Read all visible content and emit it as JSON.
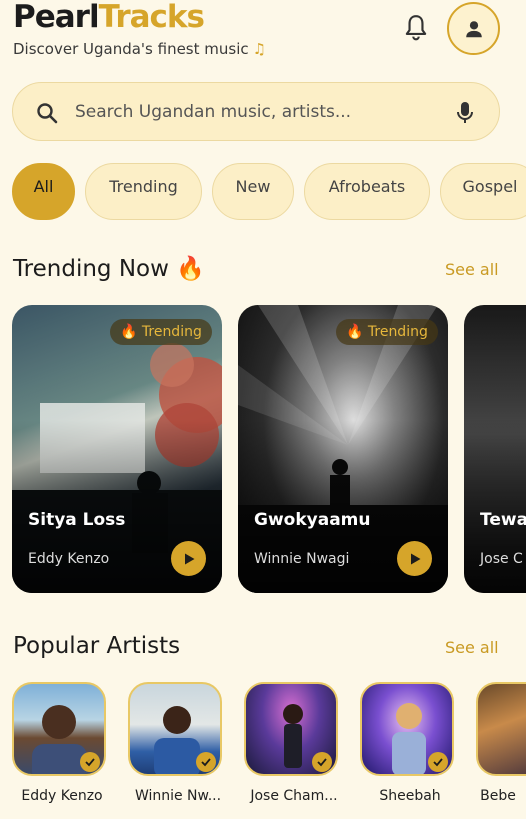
{
  "brand": {
    "part1": "Pearl",
    "part2": "Tracks"
  },
  "tagline": "Discover Uganda's finest music",
  "tagline_icon": "music-note-icon",
  "search": {
    "placeholder": "Search Ugandan music, artists..."
  },
  "filters": [
    "All",
    "Trending",
    "New",
    "Afrobeats",
    "Gospel"
  ],
  "active_filter": "All",
  "trending": {
    "title": "Trending Now 🔥",
    "see_all": "See all",
    "cards": [
      {
        "title": "Sitya Loss",
        "artist": "Eddy Kenzo",
        "badge": "🔥 Trending"
      },
      {
        "title": "Gwokyaamu",
        "artist": "Winnie Nwagi",
        "badge": "🔥 Trending"
      },
      {
        "title": "Tewa",
        "artist": "Jose C",
        "badge": ""
      }
    ]
  },
  "artists": {
    "title": "Popular Artists",
    "see_all": "See all",
    "items": [
      {
        "name": "Eddy Kenzo"
      },
      {
        "name": "Winnie Nw..."
      },
      {
        "name": "Jose Cham..."
      },
      {
        "name": "Sheebah"
      },
      {
        "name": "Bebe"
      }
    ]
  },
  "colors": {
    "accent": "#d6a52a",
    "background": "#fdf8e8",
    "chip": "#fcefc7"
  }
}
